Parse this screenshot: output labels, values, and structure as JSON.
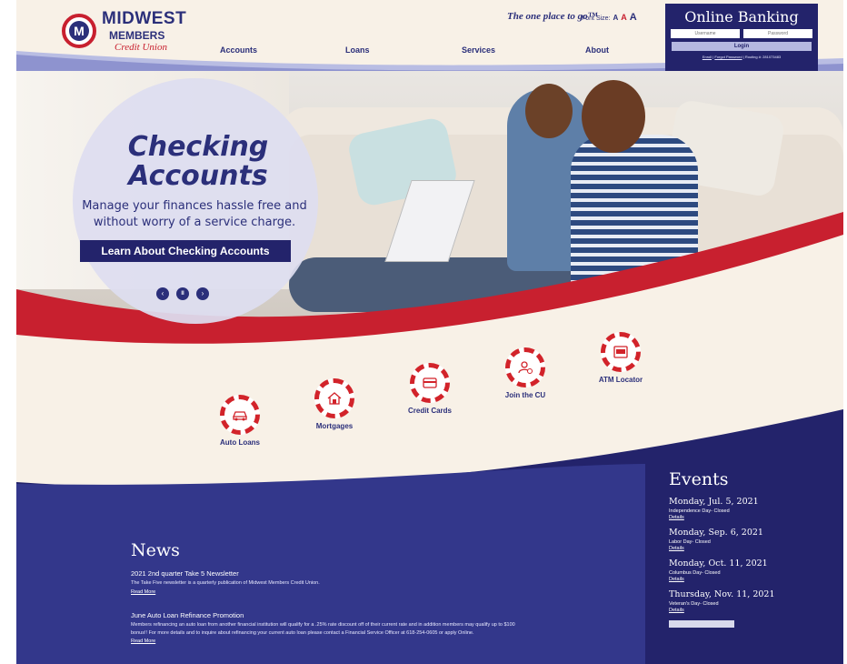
{
  "header": {
    "logo": {
      "line1": "MIDWEST",
      "line2": "MEMBERS",
      "line3": "Credit Union"
    },
    "tagline": "The one place to go™",
    "font_size": {
      "label": "Font Size:",
      "small": "A",
      "medium": "A",
      "large": "A"
    },
    "nav": [
      "Accounts",
      "Loans",
      "Services",
      "About"
    ]
  },
  "online_banking": {
    "title": "Online Banking",
    "username_placeholder": "Username",
    "password_placeholder": "Password",
    "login_label": "Login",
    "enroll": "Enroll",
    "forgot": "Forgot Password",
    "routing": "Routing #: 281073483"
  },
  "hero": {
    "title_line1": "Checking",
    "title_line2": "Accounts",
    "subtitle_line1": "Manage your finances hassle free and",
    "subtitle_line2": "without worry of a service charge.",
    "button": "Learn About Checking Accounts",
    "controls": {
      "prev": "‹",
      "pause": "II",
      "next": "›"
    }
  },
  "quick_links": [
    "Auto Loans",
    "Mortgages",
    "Credit Cards",
    "Join the CU",
    "ATM Locator"
  ],
  "news": {
    "title": "News",
    "items": [
      {
        "title": "2021 2nd quarter Take 5 Newsletter",
        "body": "The Take Five newsletter is a quarterly publication of Midwest Members Credit Union.",
        "link": "Read More"
      },
      {
        "title": "June Auto Loan Refinance Promotion",
        "body": "Members refinancing an auto loan from another financial institution will qualify for a .25% rate discount off of their current rate and in addition members may qualify up to $100 bonus!! For more details and to inquire about refinancing your current auto loan please contact a Financial Service Officer at 618-254-0605 or apply Online.",
        "link": "Read More"
      }
    ]
  },
  "events": {
    "title": "Events",
    "items": [
      {
        "date": "Monday, Jul. 5, 2021",
        "name": "Independence Day- Closed",
        "link": "Details"
      },
      {
        "date": "Monday, Sep. 6, 2021",
        "name": "Labor Day- Closed",
        "link": "Details"
      },
      {
        "date": "Monday, Oct. 11, 2021",
        "name": "Columbus Day- Closed",
        "link": "Details"
      },
      {
        "date": "Thursday, Nov. 11, 2021",
        "name": "Veteran's Day- Closed",
        "link": "Details"
      }
    ]
  },
  "colors": {
    "navy": "#23236b",
    "red": "#c8202f",
    "cream": "#f8f1e7",
    "lavender": "#b5b8e0"
  }
}
